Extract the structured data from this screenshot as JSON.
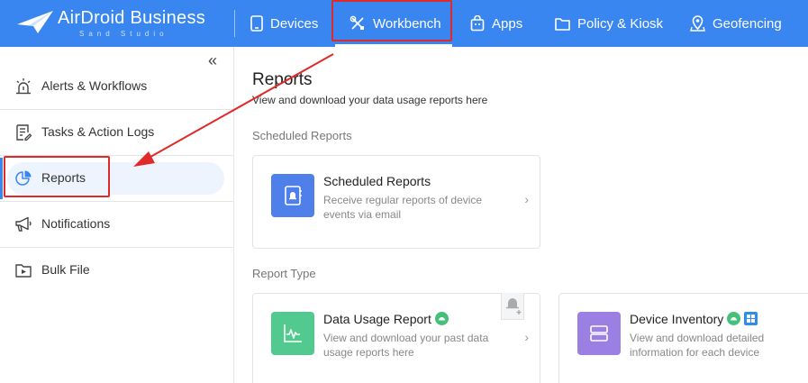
{
  "brand": {
    "name": "AirDroid Business",
    "sub": "Sand Studio"
  },
  "nav": {
    "devices": "Devices",
    "workbench": "Workbench",
    "apps": "Apps",
    "policy": "Policy & Kiosk",
    "geofencing": "Geofencing"
  },
  "sidebar": {
    "collapse_icon": "«",
    "items": [
      {
        "label": "Alerts & Workflows",
        "icon": "alarm-icon"
      },
      {
        "label": "Tasks & Action Logs",
        "icon": "task-list-icon"
      },
      {
        "label": "Reports",
        "icon": "pie-chart-icon",
        "active": true
      },
      {
        "label": "Notifications",
        "icon": "megaphone-icon"
      },
      {
        "label": "Bulk File",
        "icon": "folder-icon"
      }
    ]
  },
  "main": {
    "title": "Reports",
    "subtitle": "View and download your data usage reports here",
    "scheduled_section": "Scheduled Reports",
    "type_section": "Report Type",
    "cards": {
      "scheduled": {
        "title": "Scheduled Reports",
        "desc": "Receive regular reports of device events via email",
        "icon": "calendar-bell-icon",
        "color": "#4f7fe8"
      },
      "usage": {
        "title": "Data Usage Report",
        "desc": "View and download your past data usage reports here",
        "icon": "line-chart-icon",
        "color": "#52c98e"
      },
      "inventory": {
        "title": "Device Inventory",
        "desc": "View and download detailed information for each device",
        "icon": "server-icon",
        "color": "#9b7fe3"
      }
    },
    "chevron": "›"
  },
  "colors": {
    "nav_bg": "#3a86f0",
    "highlight_red": "#e02a2a",
    "active_bg": "#eef4fd"
  }
}
